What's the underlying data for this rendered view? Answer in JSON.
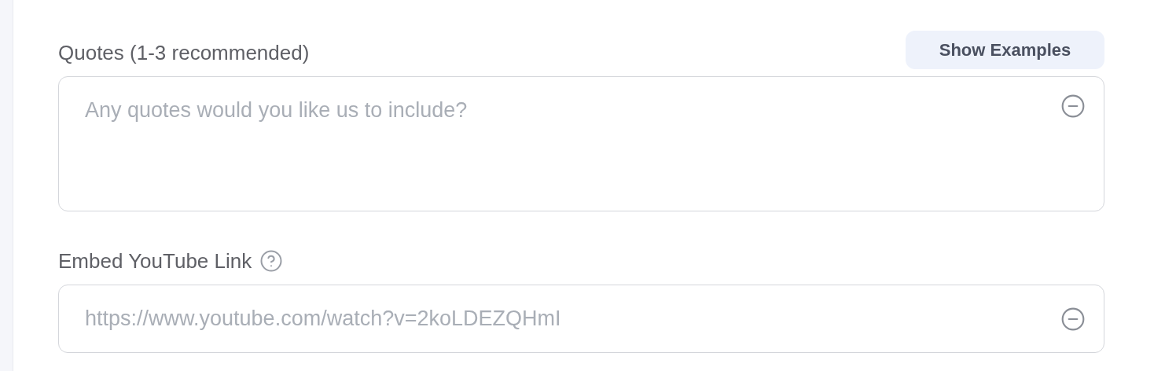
{
  "fields": [
    {
      "kind": "textarea",
      "label": "Quotes (1-3 recommended)",
      "help": false,
      "action": "Show Examples",
      "placeholder": "Any quotes would you like us to include?"
    },
    {
      "kind": "input",
      "label": "Embed YouTube Link",
      "help": true,
      "placeholder": "https://www.youtube.com/watch?v=2koLDEZQHmI"
    }
  ]
}
